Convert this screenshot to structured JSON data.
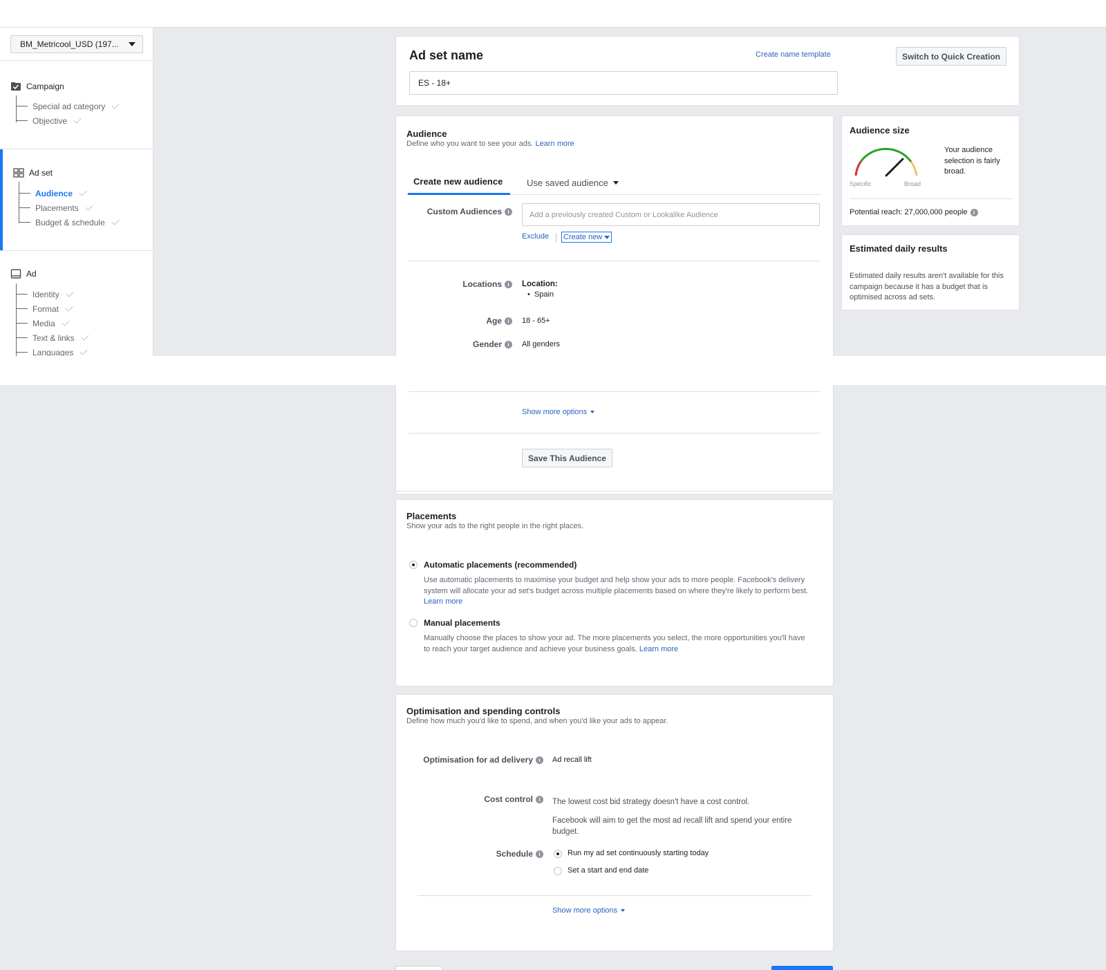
{
  "sidebar": {
    "account": "BM_Metricool_USD (197...",
    "campaign": {
      "label": "Campaign",
      "items": [
        "Special ad category",
        "Objective"
      ]
    },
    "adset": {
      "label": "Ad set",
      "items": [
        "Audience",
        "Placements",
        "Budget & schedule"
      ]
    },
    "ad": {
      "label": "Ad",
      "items": [
        "Identity",
        "Format",
        "Media",
        "Text & links",
        "Languages"
      ]
    }
  },
  "adset_name": {
    "title": "Ad set name",
    "template_link": "Create name template",
    "quick_creation_button": "Switch to Quick Creation",
    "value": "ES - 18+"
  },
  "audience": {
    "title": "Audience",
    "subtitle": "Define who you want to see your ads.",
    "learn_more": "Learn more",
    "tab_create": "Create new audience",
    "tab_saved": "Use saved audience",
    "custom_label": "Custom Audiences",
    "custom_placeholder": "Add a previously created Custom or Lookalike Audience",
    "exclude": "Exclude",
    "create_new": "Create new",
    "locations_label": "Locations",
    "location_heading": "Location:",
    "location_value": "Spain",
    "age_label": "Age",
    "age_value": "18 - 65+",
    "gender_label": "Gender",
    "gender_value": "All genders",
    "show_more": "Show more options",
    "save_button": "Save This Audience"
  },
  "audience_size": {
    "title": "Audience size",
    "description": "Your audience selection is fairly broad.",
    "specific": "Specific",
    "broad": "Broad",
    "potential_reach": "Potential reach: 27,000,000 people"
  },
  "estimated": {
    "title": "Estimated daily results",
    "text": "Estimated daily results aren't available for this campaign because it has a budget that is optimised across ad sets."
  },
  "placements": {
    "title": "Placements",
    "subtitle": "Show your ads to the right people in the right places.",
    "auto_label": "Automatic placements (recommended)",
    "auto_desc": "Use automatic placements to maximise your budget and help show your ads to more people. Facebook's delivery system will allocate your ad set's budget across multiple placements based on where they're likely to perform best.",
    "manual_label": "Manual placements",
    "manual_desc": "Manually choose the places to show your ad. The more placements you select, the more opportunities you'll have to reach your target audience and achieve your business goals.",
    "learn_more": "Learn more"
  },
  "optimisation": {
    "title": "Optimisation and spending controls",
    "subtitle": "Define how much you'd like to spend, and when you'd like your ads to appear.",
    "delivery_label": "Optimisation for ad delivery",
    "delivery_value": "Ad recall lift",
    "cost_label": "Cost control",
    "cost_value_1": "The lowest cost bid strategy doesn't have a cost control.",
    "cost_value_2": "Facebook will aim to get the most ad recall lift and spend your entire budget.",
    "schedule_label": "Schedule",
    "schedule_opt1": "Run my ad set continuously starting today",
    "schedule_opt2": "Set a start and end date",
    "show_more": "Show more options"
  }
}
